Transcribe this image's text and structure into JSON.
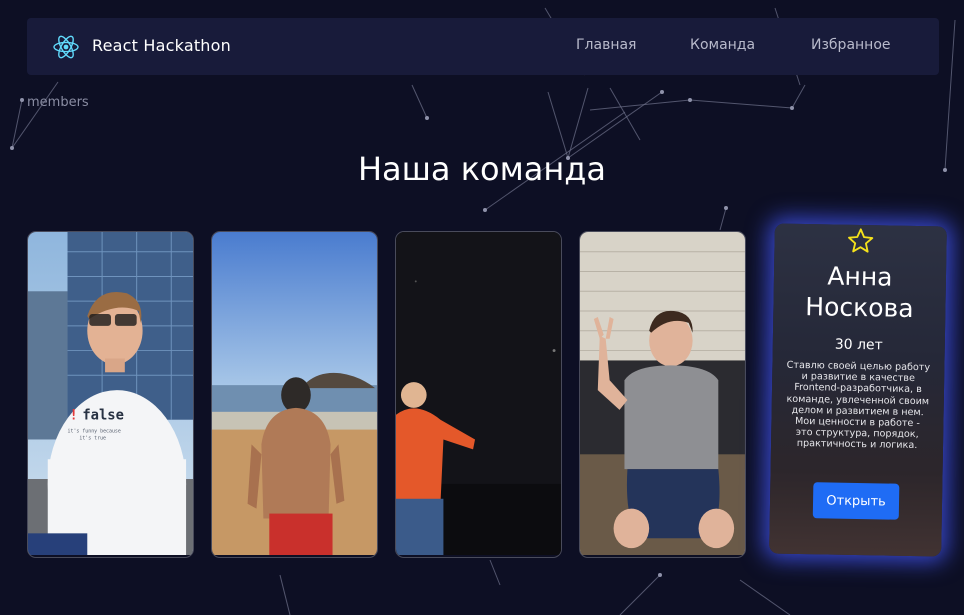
{
  "header": {
    "brand": "React Hackathon",
    "nav": [
      {
        "label": "Главная"
      },
      {
        "label": "Команда"
      },
      {
        "label": "Избранное"
      }
    ]
  },
  "breadcrumb": "members",
  "page_title": "Наша команда",
  "members": [
    {
      "photo": "man-white-tshirt-false",
      "shirt_text": "! false",
      "shirt_sub": "it's funny because it's true"
    },
    {
      "photo": "man-on-beach-back-view"
    },
    {
      "photo": "man-orange-jacket-night"
    },
    {
      "photo": "man-grey-tshirt-peace-sign"
    },
    {
      "featured": true,
      "name": "Анна Носкова",
      "name_line1": "Анна",
      "name_line2": "Носкова",
      "age": "30 лет",
      "description": "Ставлю своей целью работу и развитие в качестве Frontend-разработчика, в команде, увлеченной своим делом и развитием в нем. Мои ценности в работе - это структура, порядок, практичность и логика.",
      "button": "Открыть"
    }
  ],
  "colors": {
    "background": "#0d0f24",
    "navbar": "#181b3a",
    "accent": "#1f6cf5",
    "glow": "#465aff",
    "star": "#f5e21b"
  },
  "icons": [
    "react-logo-icon",
    "star-icon"
  ]
}
